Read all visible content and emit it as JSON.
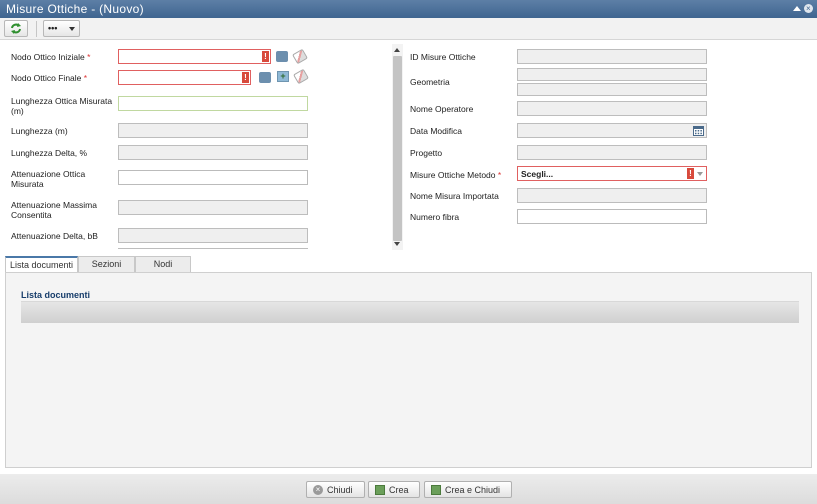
{
  "window": {
    "title": "Misure Ottiche - (Nuovo)",
    "icon": "refresh-icon",
    "more_icon": "•••"
  },
  "left_form": {
    "nodo_iniziale": {
      "label": "Nodo Ottico Iniziale",
      "required": "*"
    },
    "nodo_finale": {
      "label": "Nodo Ottico Finale",
      "required": "*"
    },
    "lunghezza_misurata": {
      "label": "Lunghezza Ottica Misurata (m)"
    },
    "lunghezza": {
      "label": "Lunghezza (m)"
    },
    "lunghezza_delta": {
      "label": "Lunghezza Delta, %"
    },
    "attenuazione_misurata": {
      "label": "Attenuazione Ottica Misurata"
    },
    "attenuazione_massima": {
      "label": "Attenuazione Massima Consentita"
    },
    "attenuazione_delta": {
      "label": "Attenuazione Delta, bB"
    }
  },
  "right_form": {
    "id_misure": {
      "label": "ID Misure Ottiche"
    },
    "geometria": {
      "label": "Geometria"
    },
    "nome_operatore": {
      "label": "Nome Operatore"
    },
    "data_modifica": {
      "label": "Data Modifica"
    },
    "progetto": {
      "label": "Progetto"
    },
    "metodo": {
      "label": "Misure Ottiche Metodo",
      "required": "*",
      "value": "Scegli..."
    },
    "nome_misura": {
      "label": "Nome Misura Importata"
    },
    "numero_fibra": {
      "label": "Numero fibra"
    }
  },
  "error_marker": "!",
  "tabs": [
    "Lista documenti",
    "Sezioni",
    "Nodi"
  ],
  "panel": {
    "title": "Lista documenti"
  },
  "footer": {
    "chiudi": "Chiudi",
    "crea": "Crea",
    "crea_chiudi": "Crea e Chiudi"
  }
}
